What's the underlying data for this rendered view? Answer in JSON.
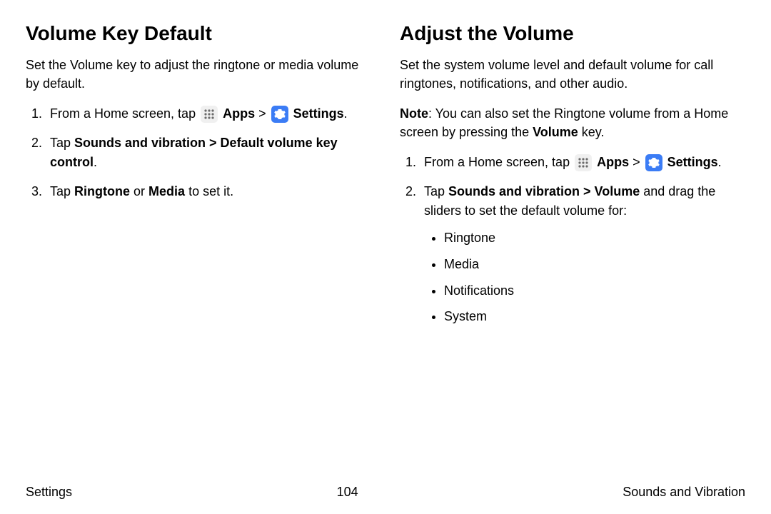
{
  "left": {
    "heading": "Volume Key Default",
    "intro": "Set the Volume key to adjust the ringtone or media volume by default.",
    "step1_a": "From a Home screen, tap ",
    "step1_apps": "Apps",
    "step1_gt": " > ",
    "step1_settings": "Settings",
    "step1_period": ".",
    "step2_a": "Tap ",
    "step2_b": "Sounds and vibration > Default volume key control",
    "step2_c": ".",
    "step3_a": "Tap ",
    "step3_b": "Ringtone",
    "step3_c": " or ",
    "step3_d": "Media",
    "step3_e": " to set it."
  },
  "right": {
    "heading": "Adjust the Volume",
    "intro": "Set the system volume level and default volume for call ringtones, notifications, and other audio.",
    "note_a": "Note",
    "note_b": ": You can also set the Ringtone volume from a Home screen by pressing the ",
    "note_c": "Volume",
    "note_d": " key.",
    "step1_a": "From a Home screen, tap ",
    "step1_apps": "Apps",
    "step1_gt": " > ",
    "step1_settings": "Settings",
    "step1_period": ".",
    "step2_a": "Tap ",
    "step2_b": "Sounds and vibration > Volume",
    "step2_c": " and drag the sliders to set the default volume for:",
    "bullets": {
      "b1": "Ringtone",
      "b2": "Media",
      "b3": "Notifications",
      "b4": "System"
    }
  },
  "footer": {
    "left": "Settings",
    "center": "104",
    "right": "Sounds and Vibration"
  }
}
